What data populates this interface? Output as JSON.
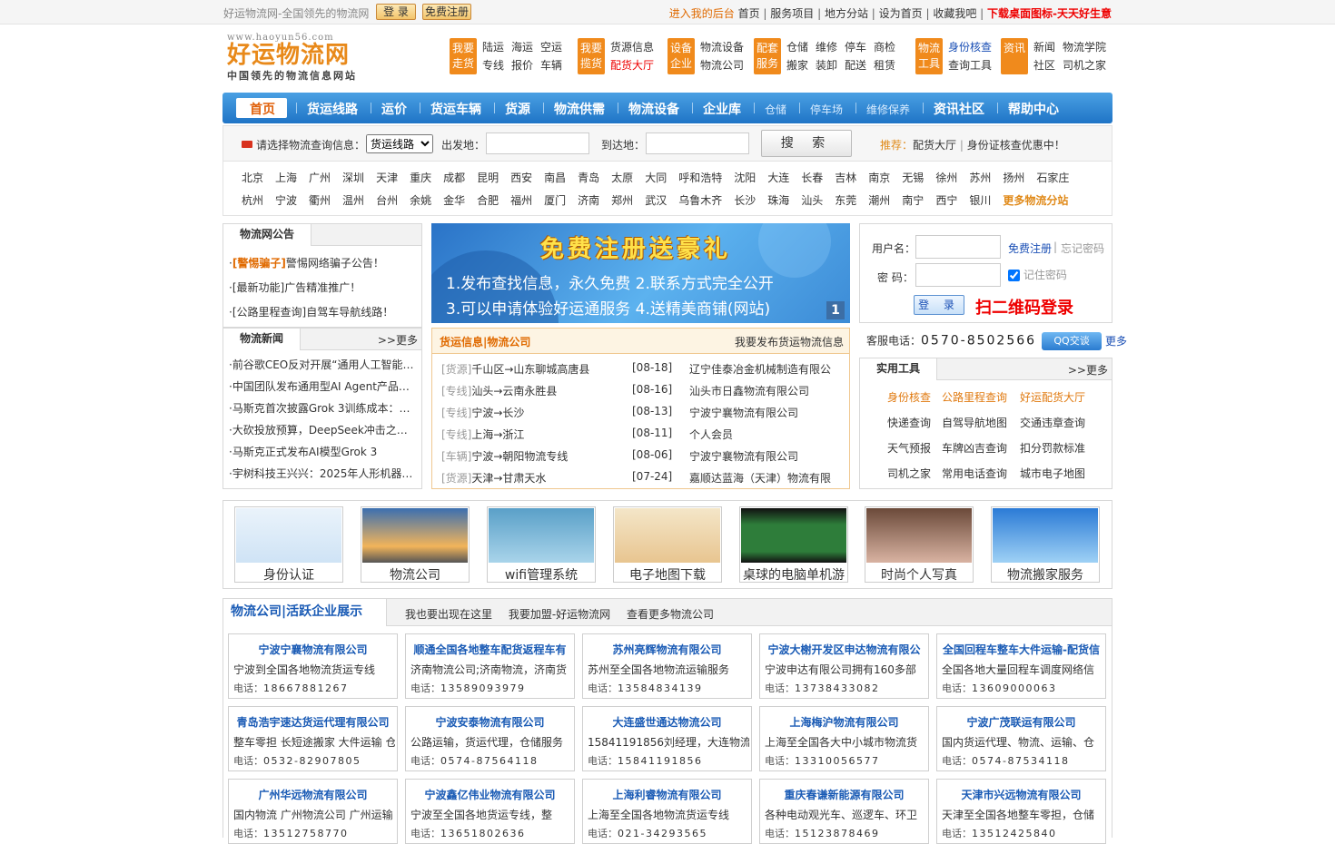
{
  "topbar": {
    "slogan": "好运物流网-全国领先的物流网",
    "login": "登 录",
    "register": "免费注册",
    "backend": "进入我的后台",
    "home": "首页",
    "services": "服务项目",
    "branches": "地方分站",
    "sethome": "设为首页",
    "fav": "收藏我吧",
    "download": "下载桌面图标-天天好生意"
  },
  "logo": {
    "url": "www.haoyun56.com",
    "name": "好运物流网",
    "sub": "中国领先的物流信息网站"
  },
  "categories": [
    {
      "tag": "我要走货",
      "rows": [
        [
          "陆运",
          "海运",
          "空运"
        ],
        [
          "专线",
          "报价",
          "车辆"
        ]
      ]
    },
    {
      "tag": "我要揽货",
      "rows": [
        [
          "货源信息"
        ],
        [
          "配货大厅"
        ]
      ]
    },
    {
      "tag": "设备企业",
      "rows": [
        [
          "物流设备"
        ],
        [
          "物流公司"
        ]
      ]
    },
    {
      "tag": "配套服务",
      "rows": [
        [
          "仓储",
          "维修",
          "停车",
          "商检"
        ],
        [
          "搬家",
          "装卸",
          "配送",
          "租赁"
        ]
      ]
    },
    {
      "tag": "物流工具",
      "rows": [
        [
          "身份核查"
        ],
        [
          "查询工具"
        ]
      ]
    },
    {
      "tag": "资讯",
      "rows": [
        [
          "新闻",
          "物流学院"
        ],
        [
          "社区",
          "司机之家"
        ]
      ]
    }
  ],
  "nav": [
    "首页",
    "货运线路",
    "运价",
    "货运车辆",
    "货源",
    "物流供需",
    "物流设备",
    "企业库",
    "仓储",
    "停车场",
    "维修保养",
    "资讯社区",
    "帮助中心"
  ],
  "search": {
    "prompt": "请选择物流查询信息：",
    "select": "货运线路",
    "from": "出发地：",
    "to": "到达地：",
    "button": "搜 索",
    "rec_label": "推荐：",
    "rec1": "配货大厅",
    "rec2": "身份证核查优惠中！"
  },
  "cities": {
    "row1": [
      "北京",
      "上海",
      "广州",
      "深圳",
      "天津",
      "重庆",
      "成都",
      "昆明",
      "西安",
      "南昌",
      "青岛",
      "太原",
      "大同",
      "呼和浩特",
      "沈阳",
      "大连",
      "长春",
      "吉林",
      "南京",
      "无锡",
      "徐州",
      "苏州",
      "扬州",
      "石家庄"
    ],
    "row2": [
      "杭州",
      "宁波",
      "衢州",
      "温州",
      "台州",
      "余姚",
      "金华",
      "合肥",
      "福州",
      "厦门",
      "济南",
      "郑州",
      "武汉",
      "乌鲁木齐",
      "长沙",
      "珠海",
      "汕头",
      "东莞",
      "潮州",
      "南宁",
      "西宁",
      "银川"
    ],
    "more": "更多物流分站"
  },
  "notice": {
    "title": "物流网公告",
    "items": [
      {
        "tag": "[警惕骗子]",
        "text": "警惕网络骗子公告！"
      },
      {
        "tag": "",
        "text": "[最新功能]广告精准推广！"
      },
      {
        "tag": "",
        "text": "[公路里程查询]自驾车导航线路！"
      }
    ]
  },
  "news": {
    "title": "物流新闻",
    "more": ">>更多",
    "items": [
      "·前谷歌CEO反对开展“通用人工智能…",
      "·中国团队发布通用型AI Agent产品…",
      "·马斯克首次披露Grok 3训练成本：…",
      "·大砍投放预算，DeepSeek冲击之下…",
      "·马斯克正式发布AI模型Grok 3",
      "·宇树科技王兴兴：2025年人形机器…"
    ]
  },
  "banner": {
    "title": "免费注册送豪礼",
    "line1": "1.发布查找信息，永久免费 2.联系方式完全公开",
    "line2": "3.可以申请体验好运通服务 4.送精美商铺(网站)",
    "page": "1"
  },
  "cargo": {
    "title": "货运信息|物流公司",
    "publish": "我要发布货运物流信息",
    "rows": [
      {
        "type": "[货源]",
        "route": "千山区→山东聊城高唐县",
        "date": "[08-18]",
        "company": "辽宁佳泰冶金机械制造有限公"
      },
      {
        "type": "[专线]",
        "route": "汕头→云南永胜县",
        "date": "[08-16]",
        "company": "汕头市日鑫物流有限公司"
      },
      {
        "type": "[专线]",
        "route": "宁波→长沙",
        "date": "[08-13]",
        "company": "宁波宁襄物流有限公司"
      },
      {
        "type": "[专线]",
        "route": "上海→浙江",
        "date": "[08-11]",
        "company": "个人会员"
      },
      {
        "type": "[车辆]",
        "route": "宁波→朝阳物流专线",
        "date": "[08-06]",
        "company": "宁波宁襄物流有限公司"
      },
      {
        "type": "[货源]",
        "route": "天津→甘肃天水",
        "date": "[07-24]",
        "company": "嘉顺达蓝海（天津）物流有限"
      }
    ]
  },
  "login": {
    "user": "用户名：",
    "pass": "密 码：",
    "register": "免费注册",
    "forgot": "忘记密码",
    "remember": "记住密码",
    "button": "登 录",
    "qr": "扫二维码登录"
  },
  "tel": {
    "label": "客服电话：",
    "number": "0570-8502566",
    "qq": "QQ交谈",
    "more": "更多"
  },
  "tools": {
    "title": "实用工具",
    "more": ">>更多",
    "items": [
      "身份核查",
      "公路里程查询",
      "好运配货大厅",
      "快递查询",
      "自驾导航地图",
      "交通违章查询",
      "天气预报",
      "车牌凶吉查询",
      "扣分罚款标准",
      "司机之家",
      "常用电话查询",
      "城市电子地图"
    ]
  },
  "pics": [
    "身份认证",
    "物流公司",
    "wifi管理系统",
    "电子地图下载",
    "桌球的电脑单机游",
    "时尚个人写真",
    "物流搬家服务"
  ],
  "comps": {
    "title": "物流公司|活跃企业展示",
    "links": [
      "我也要出现在这里",
      "我要加盟-好运物流网",
      "查看更多物流公司"
    ],
    "tel_label": "电话：",
    "items": [
      {
        "name": "宁波宁襄物流有限公司",
        "desc": "宁波到全国各地物流货运专线",
        "tel": "18667881267"
      },
      {
        "name": "顺通全国各地整车配货返程车有",
        "desc": "济南物流公司;济南物流，济南货",
        "tel": "13589093979"
      },
      {
        "name": "苏州亮辉物流有限公司",
        "desc": "苏州至全国各地物流运输服务",
        "tel": "13584834139"
      },
      {
        "name": "宁波大榭开发区申达物流有限公",
        "desc": "宁波申达有限公司拥有160多部",
        "tel": "13738433082"
      },
      {
        "name": "全国回程车整车大件运输-配货信",
        "desc": "全国各地大量回程车调度网络信",
        "tel": "13609000063"
      },
      {
        "name": "青岛浩宇速达货运代理有限公司",
        "desc": "整车零担 长短途搬家 大件运输 仓",
        "tel": "0532-82907805"
      },
      {
        "name": "宁波安泰物流有限公司",
        "desc": "公路运输，货运代理，仓储服务",
        "tel": "0574-87564118"
      },
      {
        "name": "大连盛世通达物流公司",
        "desc": "15841191856刘经理，大连物流",
        "tel": "15841191856"
      },
      {
        "name": "上海梅沪物流有限公司",
        "desc": "上海至全国各大中小城市物流货",
        "tel": "13310056577"
      },
      {
        "name": "宁波广茂联运有限公司",
        "desc": "国内货运代理、物流、运输、仓",
        "tel": "0574-87534118"
      },
      {
        "name": "广州华远物流有限公司",
        "desc": "国内物流 广州物流公司 广州运输",
        "tel": "13512758770"
      },
      {
        "name": "宁波鑫亿伟业物流有限公司",
        "desc": "宁波至全国各地货运专线，整",
        "tel": "13651802636"
      },
      {
        "name": "上海利睿物流有限公司",
        "desc": "上海至全国各地物流货运专线",
        "tel": "021-34293565"
      },
      {
        "name": "重庆春谦新能源有限公司",
        "desc": "各种电动观光车、巡逻车、环卫",
        "tel": "15123878469"
      },
      {
        "name": "天津市兴远物流有限公司",
        "desc": "天津至全国各地整车零担，仓储",
        "tel": "13512425840"
      }
    ]
  }
}
